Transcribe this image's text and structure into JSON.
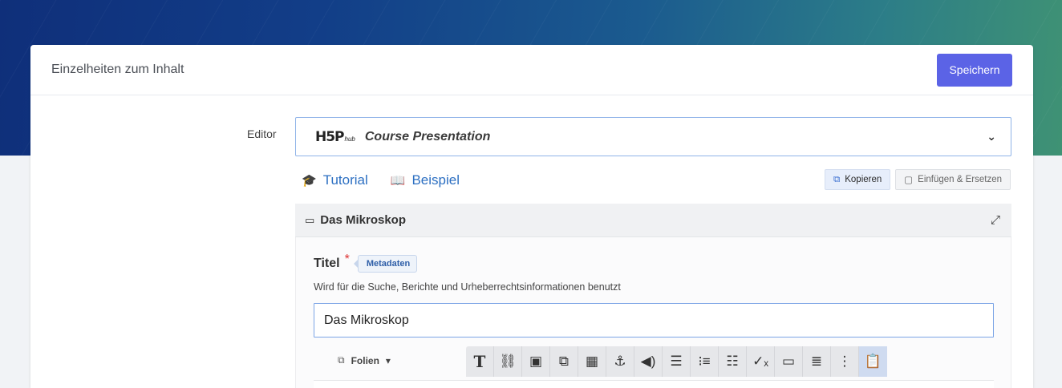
{
  "header": {
    "title": "Einzelheiten zum Inhalt",
    "save_label": "Speichern"
  },
  "editor": {
    "label": "Editor",
    "logo_text": "H5P",
    "logo_sub": "hub",
    "selected": "Course Presentation",
    "chevron_icon": "chevron-down-icon"
  },
  "links": [
    {
      "icon": "graduation-cap-icon",
      "label": "Tutorial"
    },
    {
      "icon": "open-book-icon",
      "label": "Beispiel"
    }
  ],
  "actions": {
    "copy_label": "Kopieren",
    "paste_label": "Einfügen & Ersetzen"
  },
  "section": {
    "title": "Das Mikroskop",
    "icon": "presentation-icon",
    "expand_icon": "fullscreen-expand-icon"
  },
  "field": {
    "label": "Titel",
    "required_mark": "*",
    "metadata_label": "Metadaten",
    "description": "Wird für die Suche, Berichte und Urheberrechtsinformationen benutzt",
    "value": "Das Mikroskop"
  },
  "slides_menu": {
    "label": "Folien",
    "caret": "▾"
  },
  "toolbar": {
    "items": [
      {
        "name": "text-tool",
        "glyph": "T"
      },
      {
        "name": "link-tool",
        "glyph": "⛓"
      },
      {
        "name": "image-tool",
        "glyph": "▣"
      },
      {
        "name": "shapes-tool",
        "glyph": "⧉"
      },
      {
        "name": "video-tool",
        "glyph": "▦"
      },
      {
        "name": "anchor-tool",
        "glyph": "⚓"
      },
      {
        "name": "audio-tool",
        "glyph": "◀)"
      },
      {
        "name": "fill-blanks-tool",
        "glyph": "☰"
      },
      {
        "name": "single-choice-tool",
        "glyph": "⁝≡"
      },
      {
        "name": "multi-choice-tool",
        "glyph": "☷"
      },
      {
        "name": "true-false-tool",
        "glyph": "✓ₓ"
      },
      {
        "name": "drag-text-tool",
        "glyph": "▭"
      },
      {
        "name": "summary-tool",
        "glyph": "≣"
      },
      {
        "name": "more-tool",
        "glyph": "⋮"
      },
      {
        "name": "paste-tool",
        "glyph": "📋"
      }
    ],
    "active_index": 14
  },
  "colors": {
    "accent": "#5b63e6",
    "link": "#2c6fc2",
    "required": "#dd3333"
  }
}
